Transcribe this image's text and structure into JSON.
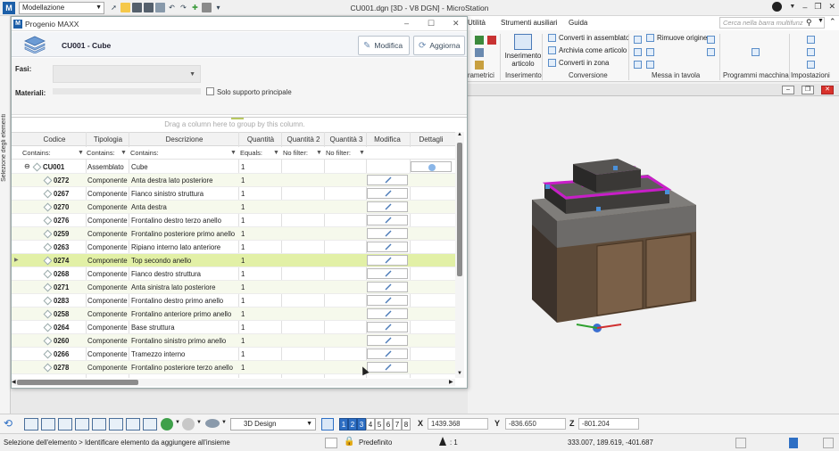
{
  "app": {
    "logo": "M",
    "workspace_select": "Modellazione",
    "window_title": "CU001.dgn [3D - V8 DGN] - MicroStation"
  },
  "ribbon": {
    "tabs": [
      "Utilità",
      "Strumenti ausiliari",
      "Guida"
    ],
    "search_placeholder": "Cerca nella barra multifunz",
    "buttons": {
      "inserimento_articolo": "Inserimento articolo",
      "converti_assemblato": "Converti in assemblato",
      "archivia_articolo": "Archivia come articolo",
      "converti_zona": "Converti in zona",
      "rimuovi_origine": "Rimuove origine"
    },
    "groups": [
      "rametrici",
      "Inserimento",
      "Conversione",
      "Messa in tavola",
      "Programmi macchina",
      "Impostazioni"
    ]
  },
  "left_strip_label": "Selezione degli elementi",
  "dialog": {
    "title": "Progenio MAXX",
    "item_name": "CU001 - Cube",
    "modifica_button": "Modifica",
    "aggiorna_button": "Aggiorna",
    "fasi_label": "Fasi:",
    "materiali_label": "Materiali:",
    "solo_supporto_label": "Solo supporto principale",
    "group_hint": "Drag a column here to group by this column.",
    "columns": [
      "Codice",
      "Tipologia",
      "Descrizione",
      "Quantità",
      "Quantità 2",
      "Quantità 3",
      "Modifica",
      "Dettagli"
    ],
    "filters": [
      "Contains:",
      "Contains:",
      "Contains:",
      "Equals:",
      "No filter:",
      "No filter:"
    ],
    "rows": [
      {
        "code": "CU001",
        "type": "Assemblato",
        "desc": "Cube",
        "qty": "1",
        "root": true
      },
      {
        "code": "0272",
        "type": "Componente",
        "desc": "Anta destra lato posteriore",
        "qty": "1"
      },
      {
        "code": "0267",
        "type": "Componente",
        "desc": "Fianco sinistro struttura",
        "qty": "1"
      },
      {
        "code": "0270",
        "type": "Componente",
        "desc": "Anta destra",
        "qty": "1"
      },
      {
        "code": "0276",
        "type": "Componente",
        "desc": "Frontalino destro terzo anello",
        "qty": "1"
      },
      {
        "code": "0259",
        "type": "Componente",
        "desc": "Frontalino posteriore primo anello",
        "qty": "1"
      },
      {
        "code": "0263",
        "type": "Componente",
        "desc": "Ripiano interno lato anteriore",
        "qty": "1"
      },
      {
        "code": "0274",
        "type": "Componente",
        "desc": "Top secondo anello",
        "qty": "1",
        "selected": true
      },
      {
        "code": "0268",
        "type": "Componente",
        "desc": "Fianco destro struttura",
        "qty": "1"
      },
      {
        "code": "0271",
        "type": "Componente",
        "desc": "Anta sinistra lato posteriore",
        "qty": "1"
      },
      {
        "code": "0283",
        "type": "Componente",
        "desc": "Frontalino destro primo anello",
        "qty": "1"
      },
      {
        "code": "0258",
        "type": "Componente",
        "desc": "Frontalino anteriore primo anello",
        "qty": "1"
      },
      {
        "code": "0264",
        "type": "Componente",
        "desc": "Base struttura",
        "qty": "1"
      },
      {
        "code": "0260",
        "type": "Componente",
        "desc": "Frontalino sinistro primo anello",
        "qty": "1"
      },
      {
        "code": "0266",
        "type": "Componente",
        "desc": "Tramezzo interno",
        "qty": "1"
      },
      {
        "code": "0278",
        "type": "Componente",
        "desc": "Frontalino posteriore terzo anello",
        "qty": "1"
      }
    ]
  },
  "bottom_toolbar": {
    "view_mode": "3D Design",
    "view_numbers": [
      "1",
      "2",
      "3",
      "4",
      "5",
      "6",
      "7",
      "8"
    ],
    "active_views": [
      "1",
      "2",
      "3"
    ],
    "x_label": "X",
    "x_value": "1439.368",
    "y_label": "Y",
    "y_value": "-836.650",
    "z_label": "Z",
    "z_value": "-801.204"
  },
  "status": {
    "prompt": "Selezione dell'elemento > Identificare elemento da aggiungere all'insieme",
    "level": "Predefinito",
    "selection_count": ": 1",
    "coordinates": "333.007, 189.619, -401.687"
  },
  "colors": {
    "accent": "#1c5fa8",
    "selected_row": "#e2f0a6",
    "alt_row": "#f6f9ec",
    "highlight_magenta": "#c81ec8"
  }
}
